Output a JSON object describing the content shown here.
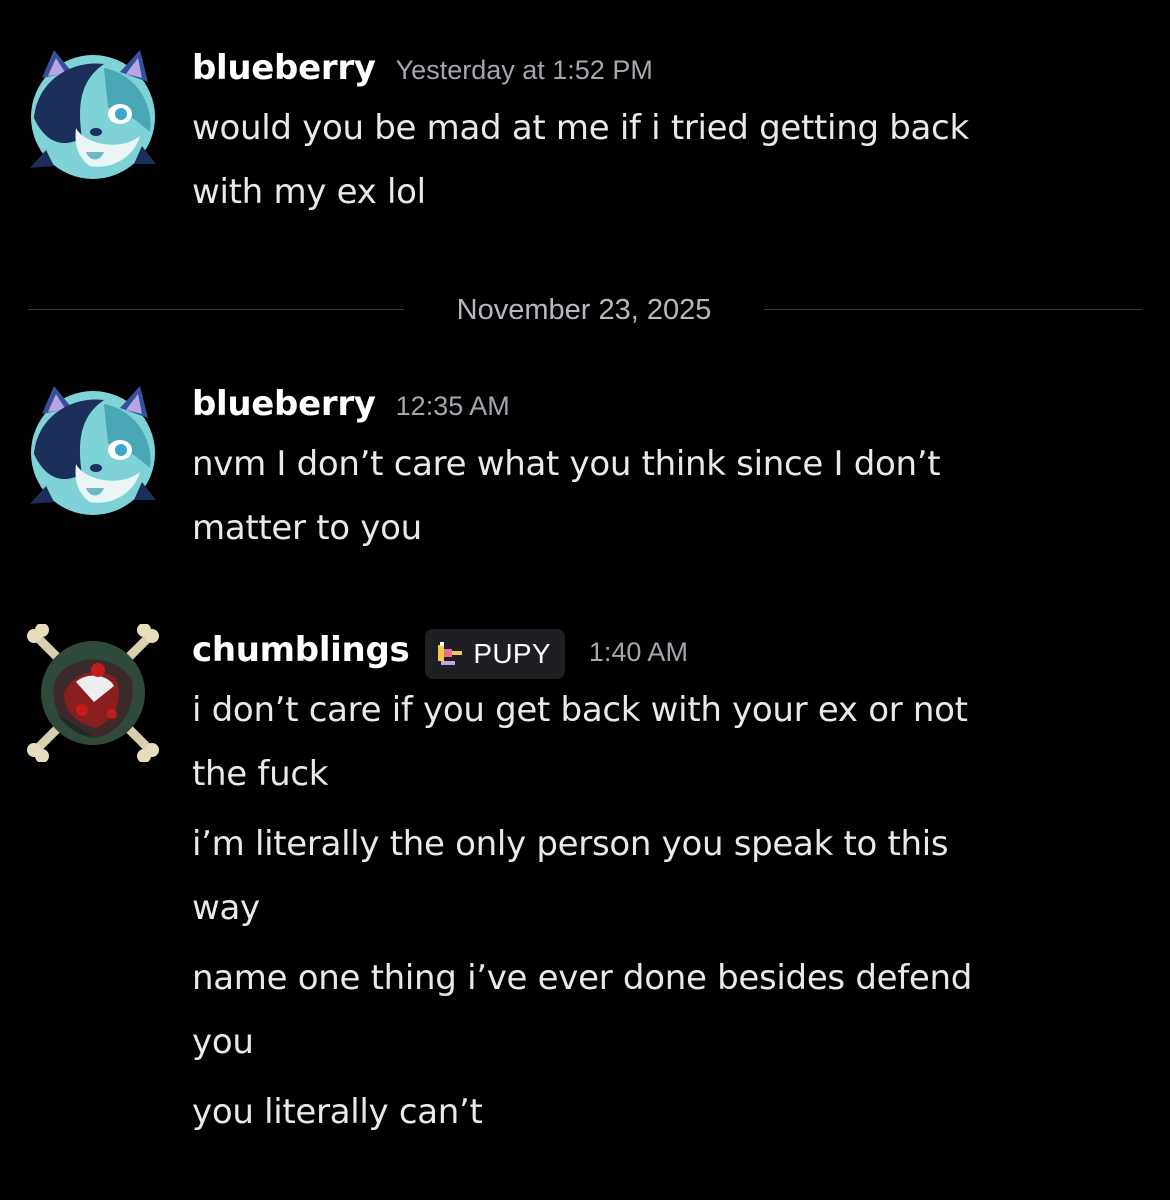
{
  "date_divider": "November 23, 2025",
  "messages": [
    {
      "username": "blueberry",
      "timestamp": "Yesterday at 1:52 PM",
      "avatar_icon": "blue-fox-avatar-icon",
      "lines": [
        [
          "would you be mad at me if i tried getting back",
          "with my ex lol"
        ]
      ]
    },
    {
      "username": "blueberry",
      "timestamp": "12:35 AM",
      "avatar_icon": "blue-fox-avatar-icon",
      "lines": [
        [
          "nvm I don’t care what you think since I don’t",
          "matter to you"
        ]
      ]
    },
    {
      "username": "chumblings",
      "badge": "PUPY",
      "badge_icon": "pupy-tag-icon",
      "timestamp": "1:40 AM",
      "avatar_icon": "skull-crossbones-avatar-icon",
      "lines": [
        [
          "i don’t care if you get back with your ex or not",
          "the fuck"
        ],
        [
          "i’m literally the only person you speak to this",
          "way"
        ],
        [
          "name one thing i’ve ever done besides defend",
          "you"
        ],
        [
          "you literally can’t"
        ]
      ]
    }
  ],
  "colors": {
    "background": "#000000",
    "username": "#ffffff",
    "message_text": "#e9e9ec",
    "timestamp": "#a3a6ad",
    "divider": "#3a3b40",
    "badge_bg": "#1e1f23"
  }
}
